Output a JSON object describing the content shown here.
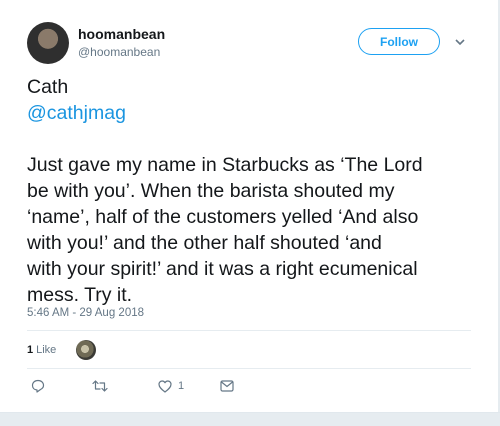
{
  "author": {
    "display_name": "hoomanbean",
    "handle": "@hoomanbean"
  },
  "follow_label": "Follow",
  "tweet": {
    "line1": "Cath",
    "mention": "@cathjmag",
    "body_lines": [
      "Just gave my name in Starbucks as ‘The Lord",
      "be with you’. When the barista shouted my",
      "‘name’, half of the customers yelled ‘And also",
      "with you!’ and the other half shouted ‘and",
      "with your spirit!’ and it was a right ecumenical",
      "mess. Try it."
    ]
  },
  "timestamp": "5:46 AM - 29 Aug 2018",
  "likes": {
    "count": "1",
    "label": "Like"
  },
  "actions": {
    "like_count": "1"
  },
  "icons": [
    "caret-down-icon",
    "reply-icon",
    "retweet-icon",
    "heart-icon",
    "message-icon"
  ],
  "colors": {
    "accent": "#1da1f2",
    "mention": "#1b95e0",
    "muted": "#657786",
    "text": "#14171a"
  }
}
